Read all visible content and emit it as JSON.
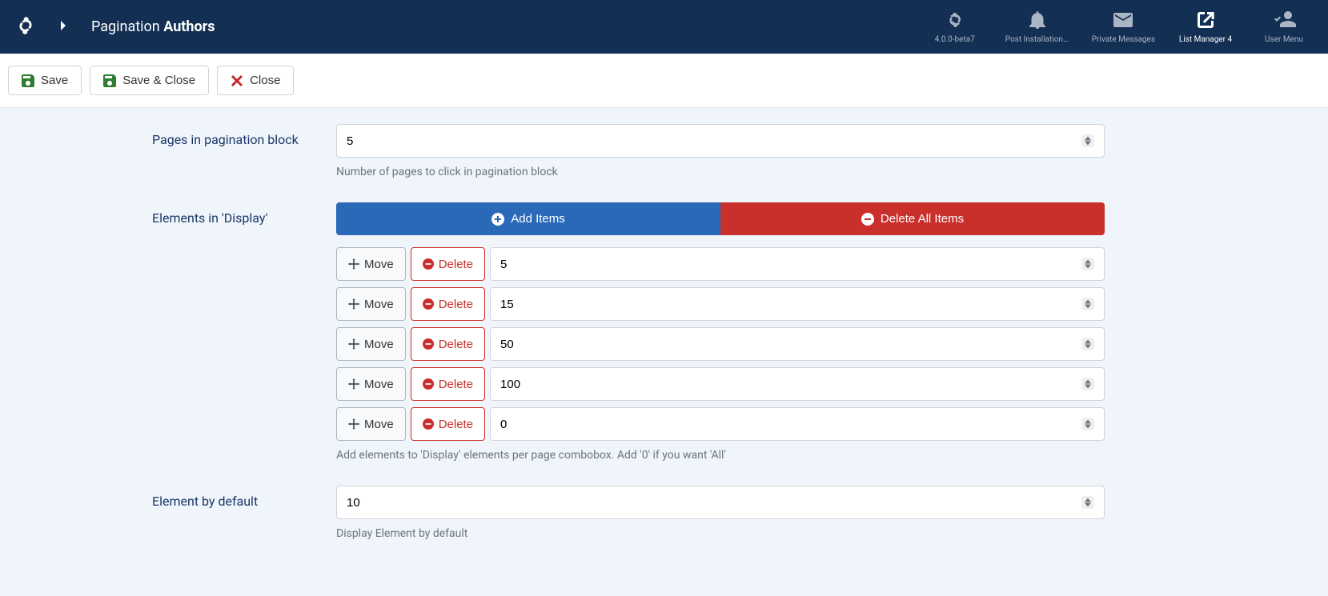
{
  "header": {
    "title_prefix": "Pagination ",
    "title_bold": "Authors"
  },
  "topbar": {
    "version": "4.0.0-beta7",
    "post_install": "Post Installation ...",
    "private_messages": "Private Messages",
    "list_manager": "List Manager 4",
    "user_menu": "User Menu"
  },
  "toolbar": {
    "save": "Save",
    "save_close": "Save & Close",
    "close": "Close"
  },
  "form": {
    "pages_label": "Pages in pagination block",
    "pages_value": "5",
    "pages_help": "Number of pages to click in pagination block",
    "elements_label": "Elements in 'Display'",
    "add_items": "Add Items",
    "delete_all": "Delete All Items",
    "move": "Move",
    "delete": "Delete",
    "items": [
      {
        "value": "5"
      },
      {
        "value": "15"
      },
      {
        "value": "50"
      },
      {
        "value": "100"
      },
      {
        "value": "0"
      }
    ],
    "elements_help": "Add elements to 'Display' elements per page combobox. Add '0' if you want 'All'",
    "default_label": "Element by default",
    "default_value": "10",
    "default_help": "Display Element by default"
  }
}
